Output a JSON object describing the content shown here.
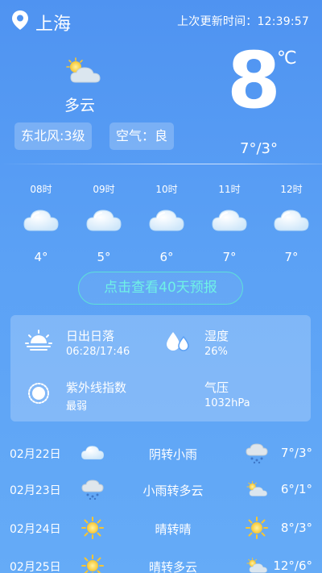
{
  "header": {
    "city": "上海",
    "updated": "上次更新时间：12:39:57",
    "location_icon": "location-pin-icon"
  },
  "current": {
    "condition": "多云",
    "icon": "partly-cloudy-icon",
    "wind": "东北风:3级",
    "air": "空气：良",
    "temp": "8",
    "unit": "℃",
    "range": "7°/3°"
  },
  "hourly": [
    {
      "time": "08时",
      "temp": "4°",
      "icon": "cloud-icon"
    },
    {
      "time": "09时",
      "temp": "5°",
      "icon": "cloud-icon"
    },
    {
      "time": "10时",
      "temp": "6°",
      "icon": "cloud-icon"
    },
    {
      "time": "11时",
      "temp": "7°",
      "icon": "cloud-icon"
    },
    {
      "time": "12时",
      "temp": "7°",
      "icon": "cloud-icon"
    }
  ],
  "forecast_button": "点击查看40天预报",
  "details": {
    "sunrise_label": "日出日落",
    "sunrise_value": "06:28/17:46",
    "humidity_label": "湿度",
    "humidity_value": "26%",
    "uv_label": "紫外线指数",
    "uv_value": "最弱",
    "pressure_label": "气压",
    "pressure_value": "1032hPa"
  },
  "daily": [
    {
      "date": "02月22日",
      "condition": "阴转小雨",
      "range": "7°/3°",
      "icon_left": "cloud-icon",
      "icon_right": "rain-cloud-icon"
    },
    {
      "date": "02月23日",
      "condition": "小雨转多云",
      "range": "6°/1°",
      "icon_left": "rain-cloud-icon",
      "icon_right": "partly-cloudy-icon"
    },
    {
      "date": "02月24日",
      "condition": "晴转晴",
      "range": "8°/3°",
      "icon_left": "sun-icon",
      "icon_right": "sun-icon"
    },
    {
      "date": "02月25日",
      "condition": "晴转多云",
      "range": "12°/6°",
      "icon_left": "sun-icon",
      "icon_right": "partly-cloudy-icon"
    }
  ],
  "colors": {
    "background": "#5ba1f5",
    "button_accent": "#6ff0e6"
  }
}
